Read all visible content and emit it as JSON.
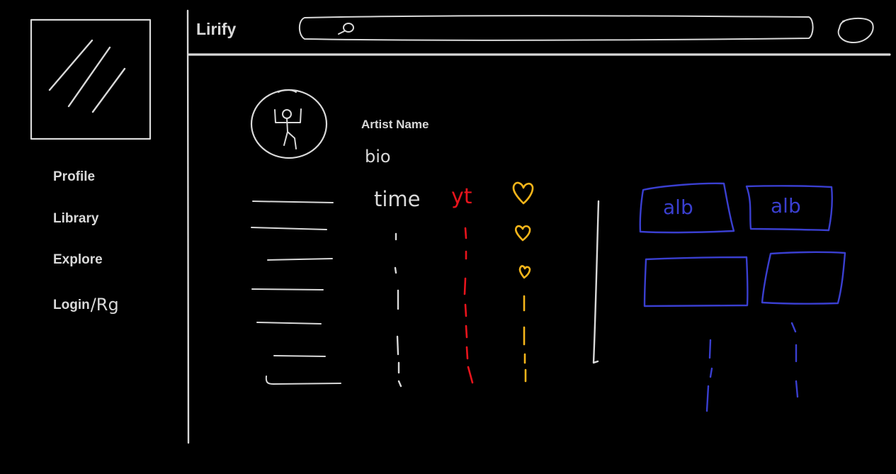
{
  "app": {
    "title": "Lirify"
  },
  "sidebar": {
    "items": [
      {
        "label": "Profile"
      },
      {
        "label": "Library"
      },
      {
        "label": "Explore"
      },
      {
        "label": "Login",
        "label_suffix": "Rg"
      }
    ]
  },
  "artist": {
    "name": "Artist Name",
    "bio": "bio"
  },
  "tracks": {
    "headers": {
      "time": "time",
      "yt": "yt",
      "like_icon": "heart-icon"
    },
    "row_count": 7
  },
  "albums": {
    "items": [
      {
        "label": "alb"
      },
      {
        "label": "alb"
      },
      {
        "label": ""
      },
      {
        "label": ""
      }
    ]
  },
  "colors": {
    "background": "#000000",
    "sketch": "#d9d9d9",
    "yt": "#e8141c",
    "heart": "#f5b51a",
    "album": "#3a3fd0"
  }
}
